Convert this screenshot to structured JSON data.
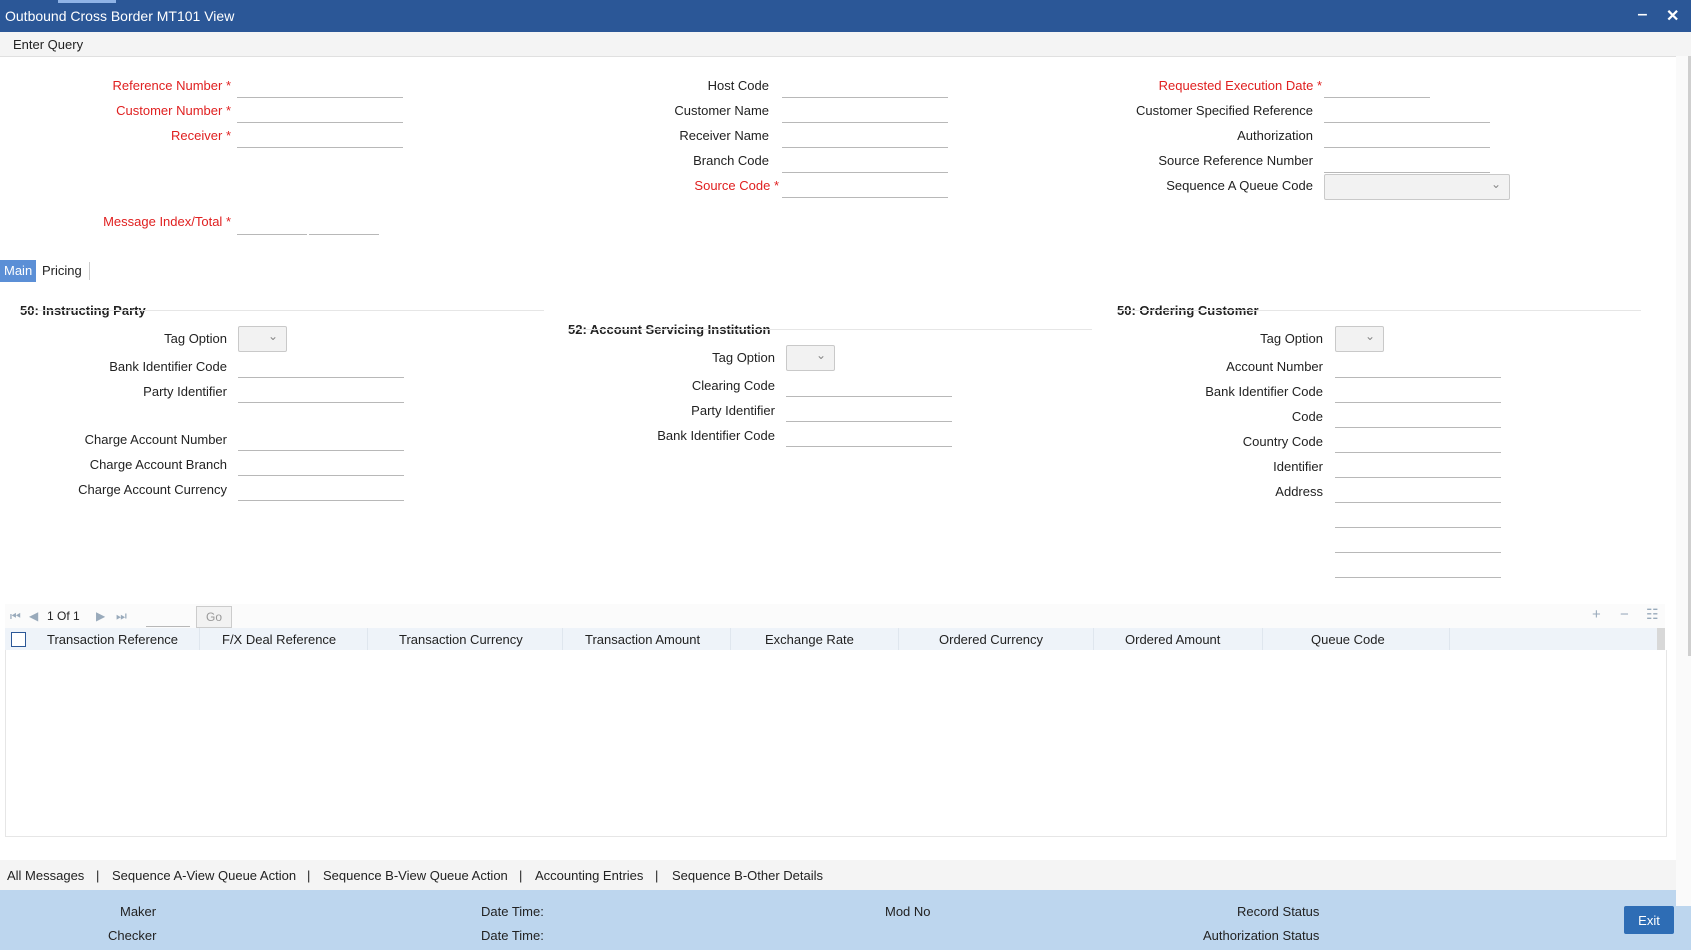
{
  "window": {
    "title": "Outbound Cross Border MT101 View",
    "minimize": "‒",
    "close": "✕"
  },
  "toolbar": {
    "enter_query": "Enter Query"
  },
  "header": {
    "reference_number": "Reference Number",
    "customer_number": "Customer Number",
    "receiver": "Receiver",
    "message_index_total": "Message Index/Total",
    "host_code": "Host Code",
    "customer_name": "Customer Name",
    "receiver_name": "Receiver Name",
    "branch_code": "Branch Code",
    "source_code": "Source Code",
    "requested_execution_date": "Requested Execution Date",
    "customer_specified_reference": "Customer Specified Reference",
    "authorization": "Authorization",
    "source_reference_number": "Source Reference Number",
    "sequence_a_queue_code": "Sequence A Queue Code",
    "required_marker": "*"
  },
  "tabs": [
    {
      "label": "Main"
    },
    {
      "label": "Pricing"
    }
  ],
  "instructing_party": {
    "title": "50: Instructing Party",
    "tag_option": "Tag Option",
    "bank_identifier_code": "Bank Identifier Code",
    "party_identifier": "Party Identifier",
    "charge_account_number": "Charge Account Number",
    "charge_account_branch": "Charge Account Branch",
    "charge_account_currency": "Charge Account Currency"
  },
  "account_servicing": {
    "title": "52: Account Servicing Institution",
    "tag_option": "Tag Option",
    "clearing_code": "Clearing Code",
    "party_identifier": "Party Identifier",
    "bank_identifier_code": "Bank Identifier Code"
  },
  "ordering_customer": {
    "title": "50: Ordering Customer",
    "tag_option": "Tag Option",
    "account_number": "Account Number",
    "bank_identifier_code": "Bank Identifier Code",
    "code": "Code",
    "country_code": "Country Code",
    "identifier": "Identifier",
    "address": "Address"
  },
  "grid": {
    "page_text": "1 Of 1",
    "go_label": "Go",
    "nav_first": "⏮",
    "nav_prev": "◀",
    "nav_next": "▶",
    "nav_last": "⏭",
    "add": "+",
    "remove": "−",
    "view": "☷",
    "columns": [
      "Transaction Reference",
      "F/X Deal Reference",
      "Transaction Currency",
      "Transaction Amount",
      "Exchange Rate",
      "Ordered Currency",
      "Ordered Amount",
      "Queue Code"
    ]
  },
  "bottom_links": [
    "All Messages",
    "|",
    "Sequence A-View Queue Action",
    "|",
    "Sequence B-View Queue Action",
    "|",
    "Accounting Entries",
    "|",
    "Sequence B-Other Details"
  ],
  "footer": {
    "maker": "Maker",
    "checker": "Checker",
    "date_time_1": "Date Time:",
    "date_time_2": "Date Time:",
    "mod_no": "Mod No",
    "record_status": "Record Status",
    "authorization_status": "Authorization Status",
    "exit": "Exit"
  }
}
